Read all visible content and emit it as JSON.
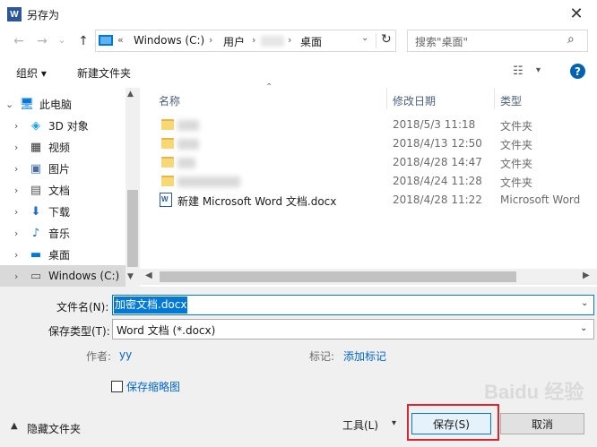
{
  "window": {
    "title": "另存为",
    "app_icon": "W",
    "close_glyph": "✕"
  },
  "nav": {
    "back_glyph": "←",
    "forward_glyph": "→",
    "history_glyph": "⌄",
    "up_glyph": "↑",
    "breadcrumbs": [
      "Windows (C:)",
      "用户",
      "桌面"
    ],
    "breadcrumb_overflow": "«",
    "search_placeholder": "搜索\"桌面\""
  },
  "toolbar": {
    "organize_label": "组织 ▾",
    "new_folder_label": "新建文件夹",
    "help_label": "?"
  },
  "sidebar": {
    "items": [
      {
        "label": "此电脑",
        "icon": "computer-icon",
        "glyph": "🖥"
      },
      {
        "label": "3D 对象",
        "icon": "cube-icon",
        "glyph": "◈"
      },
      {
        "label": "视频",
        "icon": "film-icon",
        "glyph": "▦"
      },
      {
        "label": "图片",
        "icon": "picture-icon",
        "glyph": "▣"
      },
      {
        "label": "文档",
        "icon": "document-icon",
        "glyph": "▤"
      },
      {
        "label": "下载",
        "icon": "download-icon",
        "glyph": "⬇"
      },
      {
        "label": "音乐",
        "icon": "music-icon",
        "glyph": "♪"
      },
      {
        "label": "桌面",
        "icon": "desktop-icon",
        "glyph": "▬"
      },
      {
        "label": "Windows (C:)",
        "icon": "drive-icon",
        "glyph": "▭"
      }
    ]
  },
  "file_list": {
    "columns": [
      "名称",
      "修改日期",
      "类型"
    ],
    "rows": [
      {
        "name": "",
        "date": "2018/5/3 11:18",
        "type": "文件夹",
        "kind": "folder"
      },
      {
        "name": "",
        "date": "2018/4/13 12:50",
        "type": "文件夹",
        "kind": "folder"
      },
      {
        "name": "",
        "date": "2018/4/28 14:47",
        "type": "文件夹",
        "kind": "folder"
      },
      {
        "name": "",
        "date": "2018/4/24 11:28",
        "type": "文件夹",
        "kind": "folder"
      },
      {
        "name": "新建 Microsoft Word 文档.docx",
        "date": "2018/4/28 11:22",
        "type": "Microsoft Word",
        "kind": "docx"
      }
    ]
  },
  "form": {
    "filename_label": "文件名(N):",
    "filename_value": "加密文档.docx",
    "savetype_label": "保存类型(T):",
    "savetype_value": "Word 文档 (*.docx)",
    "author_label": "作者:",
    "author_value": "yy",
    "tags_label": "标记:",
    "tags_value": "添加标记",
    "thumbnail_label": "保存缩略图"
  },
  "footer": {
    "hide_folders_label": "隐藏文件夹",
    "tools_label": "工具(L)",
    "save_label": "保存(S)",
    "cancel_label": "取消"
  },
  "watermark": "Baidu 经验",
  "colors": {
    "accent": "#0078d7",
    "highlight_outline": "#e0242c",
    "folder": "#f8d775"
  }
}
